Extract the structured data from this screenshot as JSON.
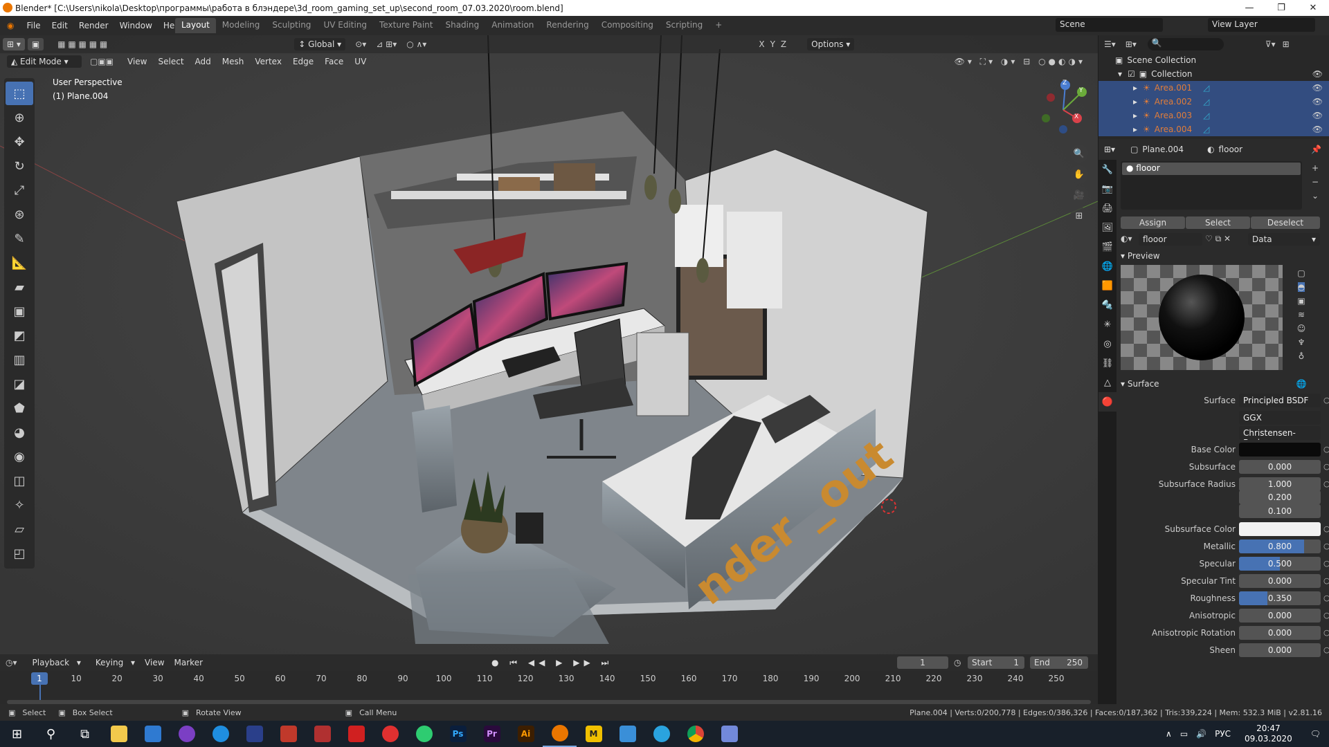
{
  "window": {
    "title": "Blender* [C:\\Users\\nikola\\Desktop\\программы\\работа в блэндере\\3d_room_gaming_set_up\\second_room_07.03.2020\\room.blend]",
    "min": "—",
    "max": "❐",
    "close": "✕"
  },
  "topmenu": [
    "File",
    "Edit",
    "Render",
    "Window",
    "Help"
  ],
  "workspaces": [
    "Layout",
    "Modeling",
    "Sculpting",
    "UV Editing",
    "Texture Paint",
    "Shading",
    "Animation",
    "Rendering",
    "Compositing",
    "Scripting",
    "+"
  ],
  "scene": "Scene",
  "view_layer": "View Layer",
  "viewport": {
    "mode": "Edit Mode",
    "menus": [
      "View",
      "Select",
      "Add",
      "Mesh",
      "Vertex",
      "Edge",
      "Face",
      "UV"
    ],
    "orientation": "Global",
    "options": "Options",
    "axes": [
      "X",
      "Y",
      "Z"
    ],
    "info_line1": "User Perspective",
    "info_line2": "(1) Plane.004",
    "watermark": "nder _out"
  },
  "gizmo": {
    "x": "X",
    "y": "Y",
    "z": "Z"
  },
  "timeline": {
    "menus": [
      "Playback",
      "Keying",
      "View",
      "Marker"
    ],
    "current": "1",
    "start_label": "Start",
    "start": "1",
    "end_label": "End",
    "end": "250",
    "ticks": [
      "1",
      "10",
      "20",
      "30",
      "40",
      "50",
      "60",
      "70",
      "80",
      "90",
      "100",
      "110",
      "120",
      "130",
      "140",
      "150",
      "160",
      "170",
      "180",
      "190",
      "200",
      "210",
      "220",
      "230",
      "240",
      "250"
    ],
    "cursor": "1"
  },
  "status": {
    "select": "Select",
    "box_select": "Box Select",
    "rotate": "Rotate View",
    "call_menu": "Call Menu",
    "stats": "Plane.004 | Verts:0/200,778 | Edges:0/386,326 | Faces:0/187,362 | Tris:339,224 | Mem: 532.3 MiB | v2.81.16"
  },
  "outliner": {
    "root": "Scene Collection",
    "collection": "Collection",
    "items": [
      "Area.001",
      "Area.002",
      "Area.003",
      "Area.004"
    ]
  },
  "properties": {
    "object": "Plane.004",
    "material": "flooor",
    "slot": "flooor",
    "assign": "Assign",
    "select": "Select",
    "deselect": "Deselect",
    "mat_name": "flooor",
    "data": "Data",
    "preview_label": "Preview",
    "surface_label": "Surface",
    "rows": [
      {
        "label": "Surface",
        "value": "Principled BSDF"
      },
      {
        "label": "",
        "value": "GGX"
      },
      {
        "label": "",
        "value": "Christensen-Burley"
      },
      {
        "label": "Base Color",
        "value": ""
      },
      {
        "label": "Subsurface",
        "value": "0.000"
      },
      {
        "label": "Subsurface Radius",
        "value": "1.000"
      },
      {
        "label": "",
        "value": "0.200"
      },
      {
        "label": "",
        "value": "0.100"
      },
      {
        "label": "Subsurface Color",
        "value": ""
      },
      {
        "label": "Metallic",
        "value": "0.800"
      },
      {
        "label": "Specular",
        "value": "0.500"
      },
      {
        "label": "Specular Tint",
        "value": "0.000"
      },
      {
        "label": "Roughness",
        "value": "0.350"
      },
      {
        "label": "Anisotropic",
        "value": "0.000"
      },
      {
        "label": "Anisotropic Rotation",
        "value": "0.000"
      },
      {
        "label": "Sheen",
        "value": "0.000"
      }
    ],
    "fills": {
      "metallic": 0.8,
      "specular": 0.5,
      "roughness": 0.35
    }
  },
  "taskbar": {
    "lang": "РУС",
    "time": "20:47",
    "date": "09.03.2020",
    "apps": [
      "Ps",
      "Pr",
      "Ai",
      "M"
    ]
  },
  "colors": {
    "accent": "#4772b3",
    "selected_row": "#334d80",
    "light_orange": "#e07d3a",
    "blender_orange": "#ea7600"
  }
}
